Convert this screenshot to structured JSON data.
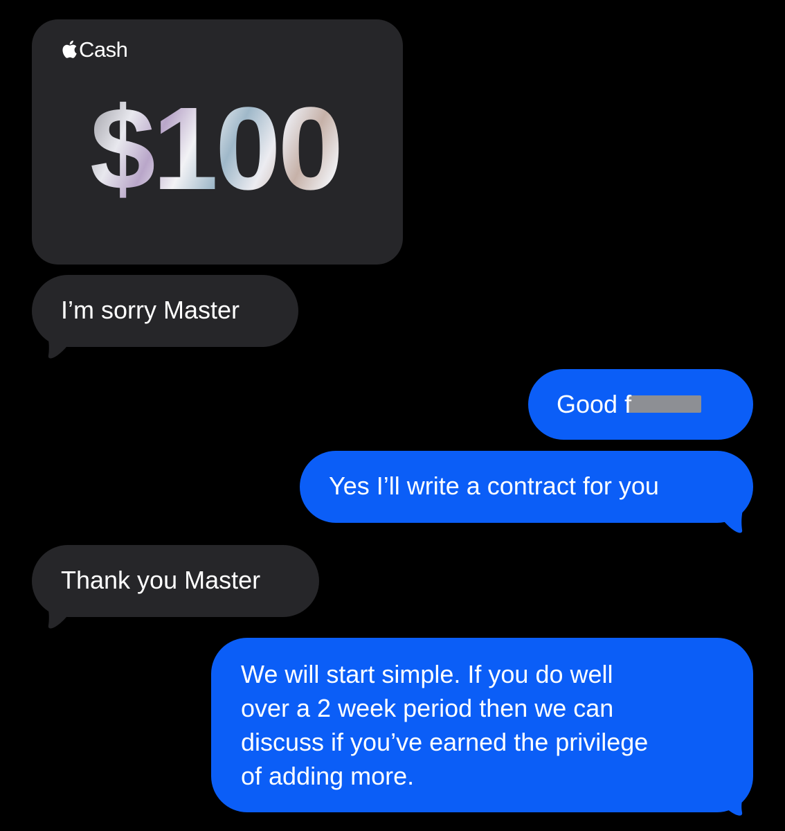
{
  "apple_cash": {
    "icon": "apple-icon",
    "label": "Cash",
    "amount": "$100"
  },
  "messages": [
    {
      "direction": "incoming",
      "text": "I’m sorry Master"
    },
    {
      "direction": "outgoing",
      "text": "Good f",
      "redacted": true
    },
    {
      "direction": "outgoing",
      "text": "Yes I’ll write a contract for you"
    },
    {
      "direction": "incoming",
      "text": "Thank you Master"
    },
    {
      "direction": "outgoing",
      "text": "We will start simple. If you do well\nover a 2 week period then we can\ndiscuss if you’ve earned the privilege\nof adding more."
    }
  ],
  "colors": {
    "background": "#000000",
    "incoming_bubble": "#262629",
    "outgoing_bubble": "#0b5ef7",
    "text": "#ffffff",
    "redaction": "#8d8f94"
  }
}
